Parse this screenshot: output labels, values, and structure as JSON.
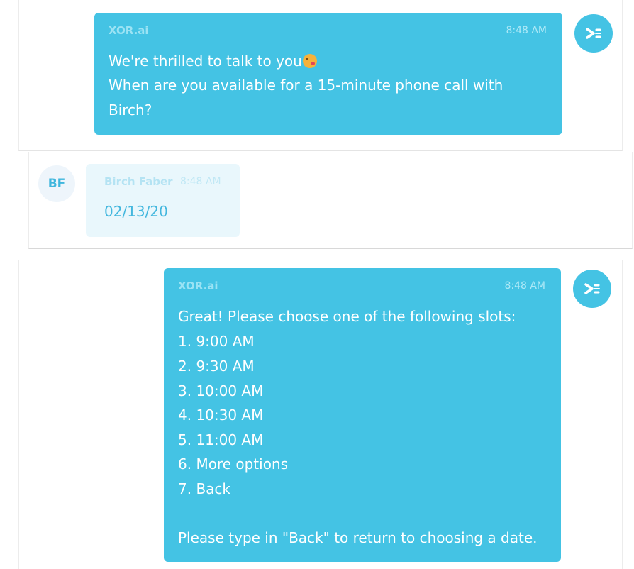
{
  "messages": [
    {
      "sender": "XOR.ai",
      "time": "8:48 AM",
      "lines": [
        "We're thrilled to talk to you",
        "When are you available for a 15-minute phone call with",
        "Birch?"
      ]
    },
    {
      "sender": "Birch Faber",
      "time": "8:48 AM",
      "initials": "BF",
      "text": "02/13/20"
    },
    {
      "sender": "XOR.ai",
      "time": "8:48 AM",
      "lines": [
        "Great! Please choose one of the following slots:",
        "1. 9:00 AM",
        "2. 9:30 AM",
        "3. 10:00 AM",
        "4. 10:30 AM",
        "5. 11:00 AM",
        "6. More options",
        "7. Back",
        "Please type in \"Back\" to return to choosing a date."
      ]
    }
  ],
  "icons": {
    "bot_avatar": "xor-logo-icon",
    "emoji": "winking-kiss-emoji-icon"
  },
  "colors": {
    "bot_bubble": "#44c3e4",
    "user_bubble": "#e9f7fc",
    "user_text": "#43b7de",
    "accent": "#44c3e4"
  }
}
